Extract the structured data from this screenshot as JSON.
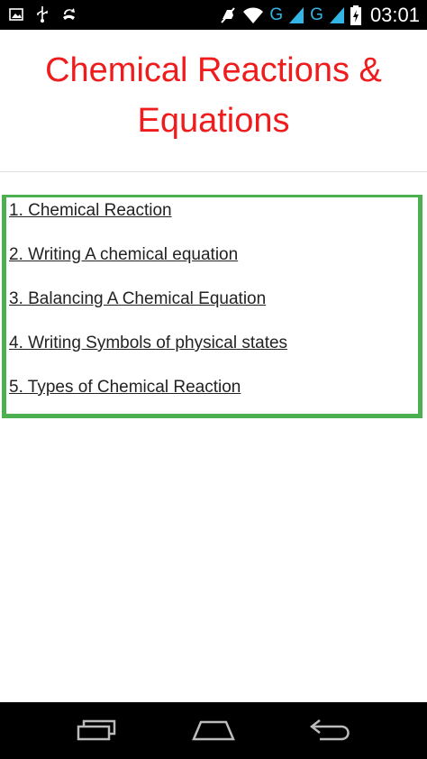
{
  "status_bar": {
    "network_1": "G",
    "network_2": "G",
    "time": "03:01",
    "icons": [
      "image-icon",
      "usb-icon",
      "missed-call-icon",
      "mute-icon",
      "wifi-icon",
      "signal-icon",
      "signal-icon",
      "battery-charging-icon"
    ]
  },
  "page": {
    "title": "Chemical Reactions & Equations"
  },
  "topics": [
    "1. Chemical Reaction",
    "2. Writing A chemical equation",
    "3. Balancing A Chemical Equation",
    "4. Writing Symbols of physical states",
    "5. Types of Chemical Reaction"
  ],
  "nav_bar": {
    "icons": [
      "recents-icon",
      "home-icon",
      "back-icon"
    ]
  },
  "colors": {
    "title": "#ee1c1c",
    "box_border": "#4caf50",
    "bars": "#000000"
  }
}
